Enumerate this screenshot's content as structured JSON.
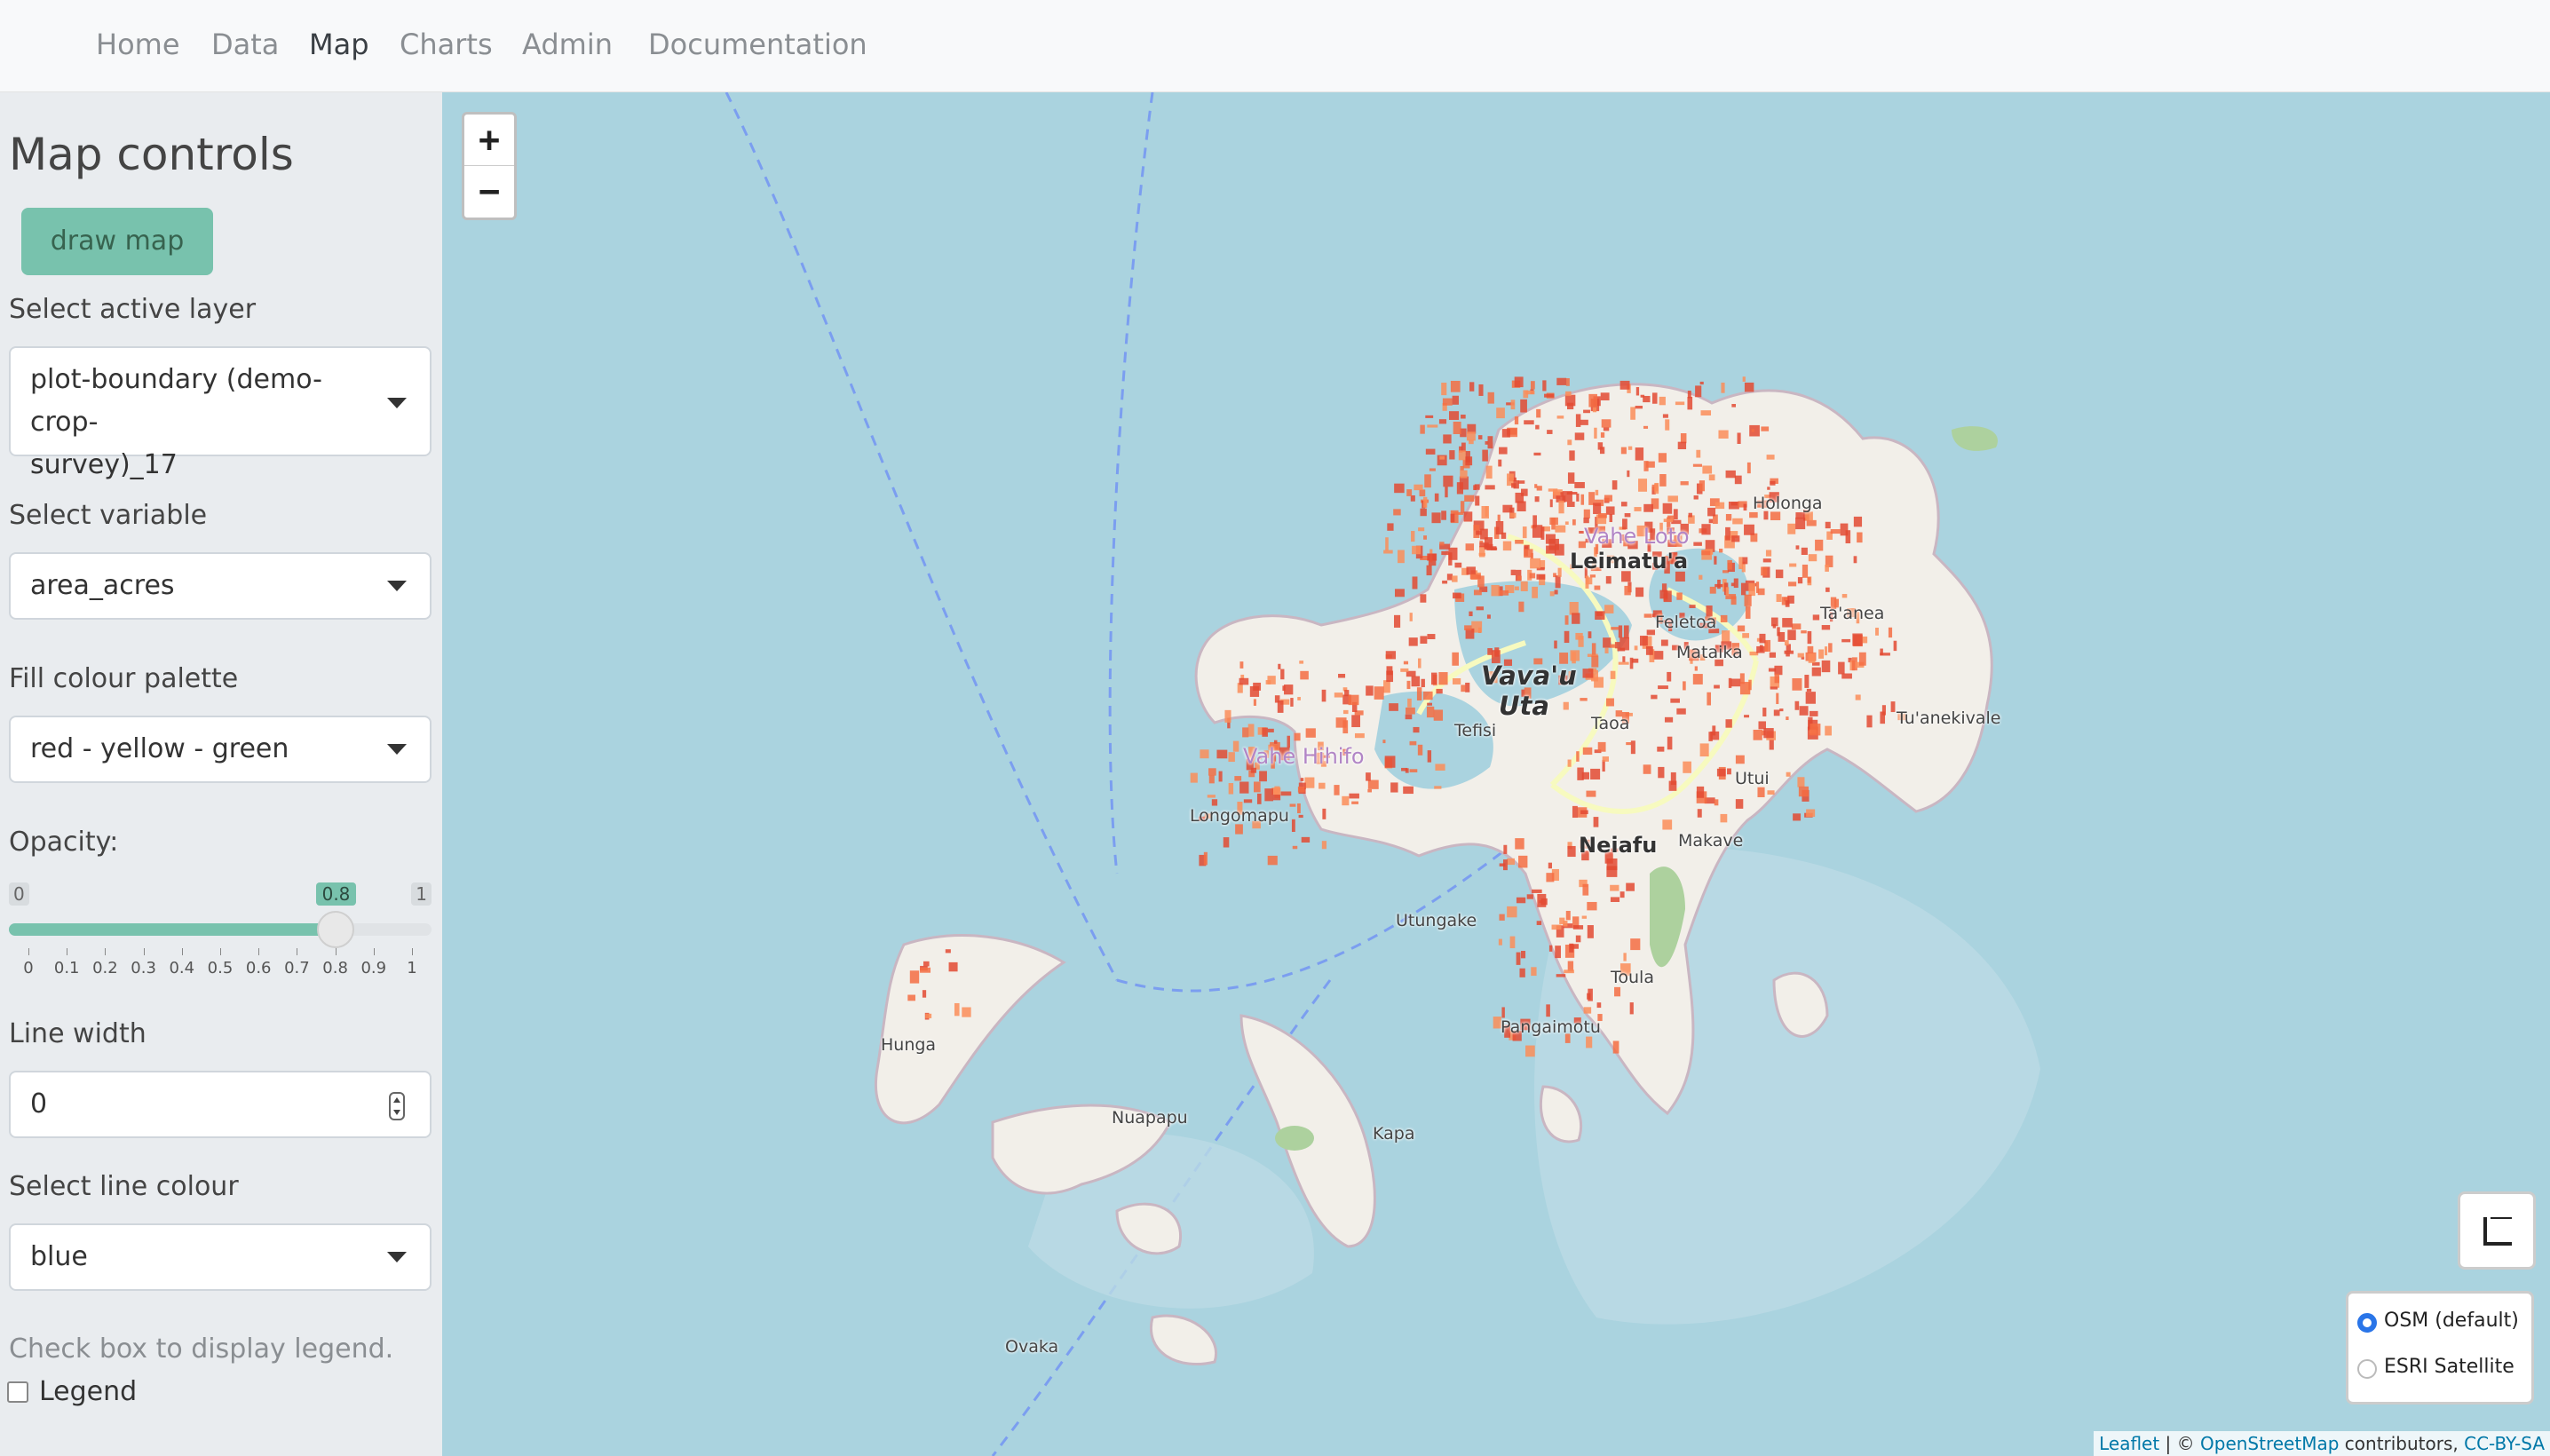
{
  "nav": {
    "items": [
      {
        "label": "Home"
      },
      {
        "label": "Data"
      },
      {
        "label": "Map"
      },
      {
        "label": "Charts"
      },
      {
        "label": "Admin"
      },
      {
        "label": "Documentation"
      }
    ],
    "active": "Map"
  },
  "sidebar": {
    "title": "Map controls",
    "draw_button": "draw map",
    "active_layer": {
      "label": "Select active layer",
      "value_line1": "plot-boundary (demo-crop-",
      "value_line2": "survey)_17"
    },
    "variable": {
      "label": "Select variable",
      "value": "area_acres"
    },
    "palette": {
      "label": "Fill colour palette",
      "value": "red - yellow - green"
    },
    "opacity": {
      "label": "Opacity:",
      "min_label": "0",
      "max_label": "1",
      "value_label": "0.8",
      "value": 0.8,
      "ticks": [
        "0",
        "0.1",
        "0.2",
        "0.3",
        "0.4",
        "0.5",
        "0.6",
        "0.7",
        "0.8",
        "0.9",
        "1"
      ]
    },
    "line_width": {
      "label": "Line width",
      "value": "0"
    },
    "line_colour": {
      "label": "Select line colour",
      "value": "blue"
    },
    "legend_help": "Check box to display legend.",
    "legend_label": "Legend",
    "legend_checked": false
  },
  "map": {
    "zoom_in": "+",
    "zoom_out": "−",
    "places": {
      "neiafu": "Neiafu",
      "leimatua": "Leimatu'a",
      "vavau1": "Vava'u",
      "vavau2": "Uta",
      "vahe_hihifo": "Vahe Hihifo",
      "vahe_loto": "Vahe Loto",
      "holonga": "Holonga",
      "feletoa": "Feletoa",
      "mataika": "Mataika",
      "taanea": "Ta'anea",
      "tuanekivale": "Tu'anekivale",
      "taoa": "Taoa",
      "tefisi": "Tefisi",
      "longomapu": "Longomapu",
      "utui": "Utui",
      "makave": "Makave",
      "utungake": "Utungake",
      "toula": "Toula",
      "pangaimotu": "Pangaimotu",
      "hunga": "Hunga",
      "nuapapu": "Nuapapu",
      "kapa": "Kapa",
      "ovaka": "Ovaka"
    },
    "basemaps": [
      {
        "label": "OSM (default)",
        "selected": true
      },
      {
        "label": "ESRI Satellite",
        "selected": false
      }
    ],
    "attribution": {
      "leaflet": "Leaflet",
      "sep": " | © ",
      "osm": "OpenStreetMap",
      "contrib": " contributors, ",
      "license": "CC-BY-SA"
    },
    "colors": {
      "sea": "#aad3df",
      "land": "#f2efe9",
      "plot_red": "#e34a33",
      "plot_orange": "#fc8d59",
      "road": "#f7fabf",
      "accent": "#78c2ad"
    }
  }
}
